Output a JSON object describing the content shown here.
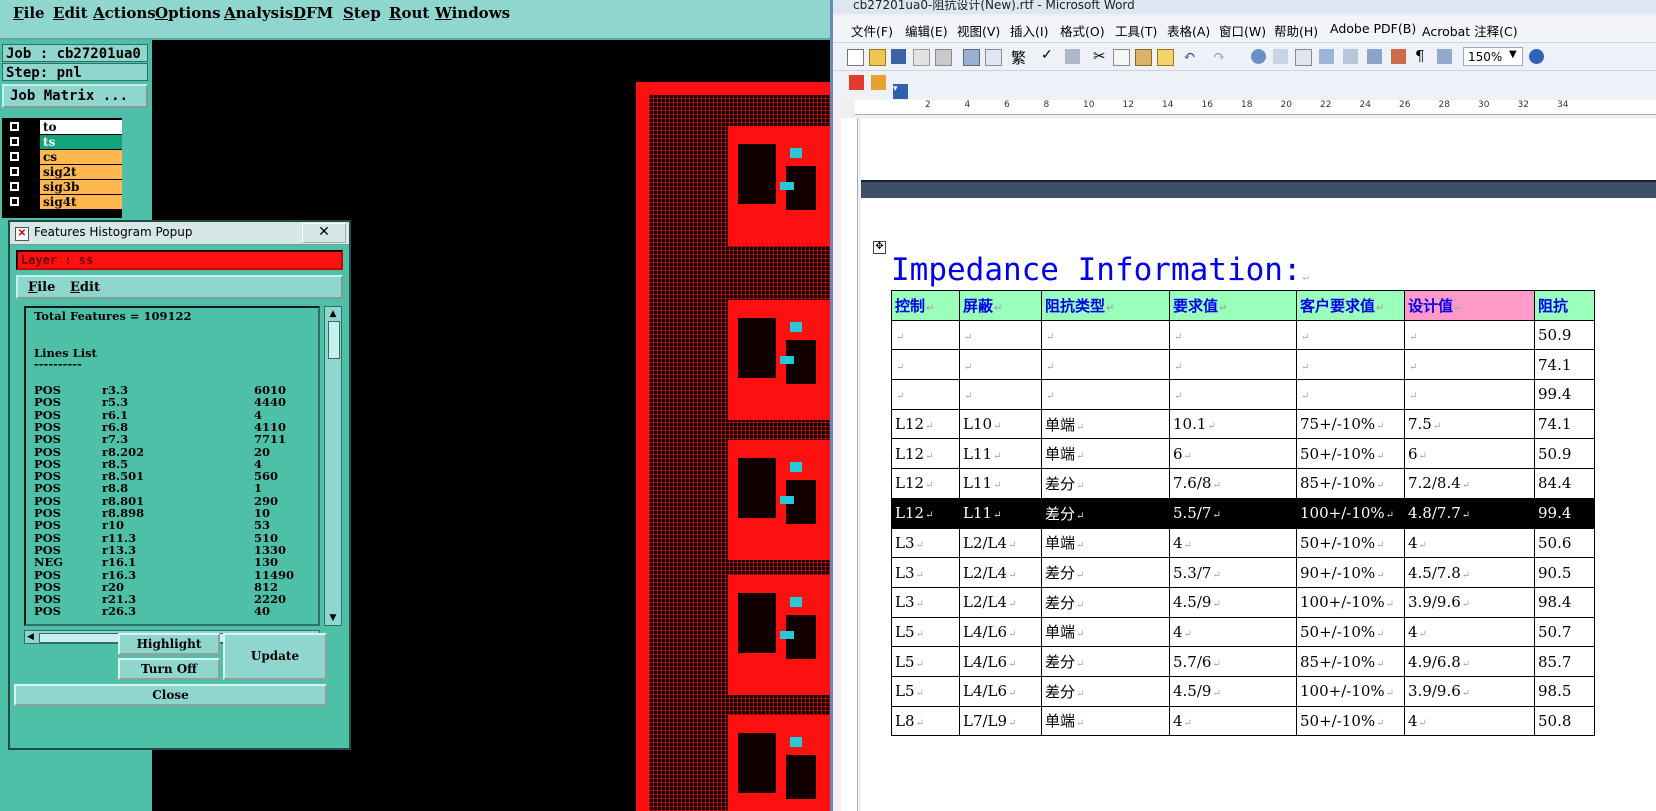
{
  "cam": {
    "menu": [
      "File",
      "Edit",
      "Actions",
      "Options",
      "Analysis",
      "DFM",
      "Step",
      "Rout",
      "Windows"
    ],
    "job_label": "Job : cb27201ua0",
    "step_label": "Step: pnl",
    "job_matrix": "Job Matrix ...",
    "layers": [
      {
        "name": "to",
        "color": "#ffffff"
      },
      {
        "name": "ts",
        "color": "#14a37a"
      },
      {
        "name": "cs",
        "color": "#ffb84d"
      },
      {
        "name": "sig2t",
        "color": "#ffb84d"
      },
      {
        "name": "sig3b",
        "color": "#ffb84d"
      },
      {
        "name": "sig4t",
        "color": "#ffb84d"
      }
    ],
    "board_color": "#ff1010",
    "popup": {
      "title": "Features Histogram Popup",
      "close_x": "✕",
      "layer_line": "Layer :  ss",
      "menu": [
        "File",
        "Edit"
      ],
      "total": "Total Features = 109122",
      "list_title": "Lines List",
      "separator": "----------",
      "rows": [
        {
          "pol": "POS",
          "sym": "r3.3",
          "count": "6010"
        },
        {
          "pol": "POS",
          "sym": "r5.3",
          "count": "4440"
        },
        {
          "pol": "POS",
          "sym": "r6.1",
          "count": "4"
        },
        {
          "pol": "POS",
          "sym": "r6.8",
          "count": "4110"
        },
        {
          "pol": "POS",
          "sym": "r7.3",
          "count": "7711"
        },
        {
          "pol": "POS",
          "sym": "r8.202",
          "count": "20"
        },
        {
          "pol": "POS",
          "sym": "r8.5",
          "count": "4"
        },
        {
          "pol": "POS",
          "sym": "r8.501",
          "count": "560"
        },
        {
          "pol": "POS",
          "sym": "r8.8",
          "count": "1"
        },
        {
          "pol": "POS",
          "sym": "r8.801",
          "count": "290"
        },
        {
          "pol": "POS",
          "sym": "r8.898",
          "count": "10"
        },
        {
          "pol": "POS",
          "sym": "r10",
          "count": "53"
        },
        {
          "pol": "POS",
          "sym": "r11.3",
          "count": "510"
        },
        {
          "pol": "POS",
          "sym": "r13.3",
          "count": "1330"
        },
        {
          "pol": "NEG",
          "sym": "r16.1",
          "count": "130"
        },
        {
          "pol": "POS",
          "sym": "r16.3",
          "count": "11490"
        },
        {
          "pol": "POS",
          "sym": "r20",
          "count": "812"
        },
        {
          "pol": "POS",
          "sym": "r21.3",
          "count": "2220"
        },
        {
          "pol": "POS",
          "sym": "r26.3",
          "count": "40"
        }
      ],
      "buttons": {
        "highlight": "Highlight",
        "turn_off": "Turn Off",
        "update": "Update",
        "close": "Close"
      }
    }
  },
  "word": {
    "title": "cb27201ua0-阻抗设计(New).rtf - Microsoft Word",
    "menu": [
      "文件(F)",
      "编辑(E)",
      "视图(V)",
      "插入(I)",
      "格式(O)",
      "工具(T)",
      "表格(A)",
      "窗口(W)",
      "帮助(H)",
      "Adobe PDF(B)",
      "Acrobat 注释(C)"
    ],
    "zoom": "150%",
    "ruler_numbers": [
      "2",
      "4",
      "6",
      "8",
      "10",
      "12",
      "14",
      "16",
      "18",
      "20",
      "22",
      "24",
      "26",
      "28",
      "30",
      "32",
      "34"
    ],
    "doc_title": "Impedance Information:",
    "paragraph_mark": "↵",
    "table": {
      "headers": [
        "控制",
        "屏蔽",
        "阻抗类型",
        "要求值",
        "客户要求值",
        "设计值",
        "阻抗"
      ],
      "rows": [
        [
          "",
          "",
          "",
          "",
          "",
          "",
          "50.9"
        ],
        [
          "",
          "",
          "",
          "",
          "",
          "",
          "74.1"
        ],
        [
          "",
          "",
          "",
          "",
          "",
          "",
          "99.4"
        ],
        [
          "L12",
          "L10",
          "单端",
          "10.1",
          "75+/-10%",
          "7.5",
          "74.1"
        ],
        [
          "L12",
          "L11",
          "单端",
          "6",
          "50+/-10%",
          "6",
          "50.9"
        ],
        [
          "L12",
          "L11",
          "差分",
          "7.6/8",
          "85+/-10%",
          "7.2/8.4",
          "84.4"
        ],
        [
          "L12",
          "L11",
          "差分",
          "5.5/7",
          "100+/-10%",
          "4.8/7.7",
          "99.4"
        ],
        [
          "L3",
          "L2/L4",
          "单端",
          "4",
          "50+/-10%",
          "4",
          "50.6"
        ],
        [
          "L3",
          "L2/L4",
          "差分",
          "5.3/7",
          "90+/-10%",
          "4.5/7.8",
          "90.5"
        ],
        [
          "L3",
          "L2/L4",
          "差分",
          "4.5/9",
          "100+/-10%",
          "3.9/9.6",
          "98.4"
        ],
        [
          "L5",
          "L4/L6",
          "单端",
          "4",
          "50+/-10%",
          "4",
          "50.7"
        ],
        [
          "L5",
          "L4/L6",
          "差分",
          "5.7/6",
          "85+/-10%",
          "4.9/6.8",
          "85.7"
        ],
        [
          "L5",
          "L4/L6",
          "差分",
          "4.5/9",
          "100+/-10%",
          "3.9/9.6",
          "98.5"
        ],
        [
          "L8",
          "L7/L9",
          "单端",
          "4",
          "50+/-10%",
          "4",
          "50.8"
        ]
      ]
    }
  }
}
